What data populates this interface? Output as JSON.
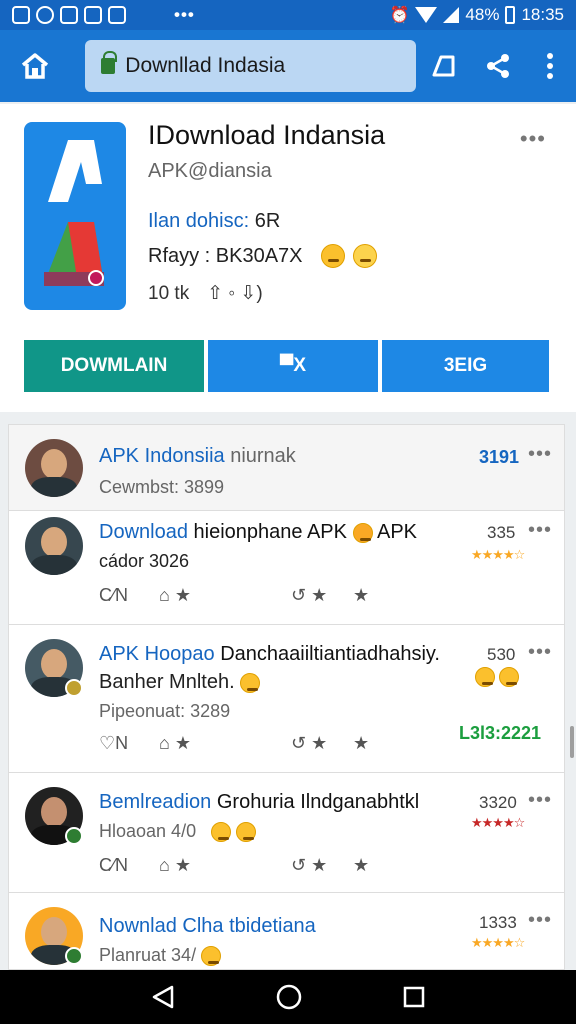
{
  "status": {
    "battery": "48%",
    "time": "18:35",
    "dots": "•••"
  },
  "toolbar": {
    "url_text": "Downllad Indasia"
  },
  "app": {
    "name": "IDownload Indansia",
    "subtitle": "APK@diansia",
    "meta1_label": "Ilan dohisc:",
    "meta1_value": "6R",
    "meta2_text": "Rfayy : BK30A7X",
    "meta3_count": "10 tk",
    "meta3_actions": "⇧ ◦ ⇩)",
    "more": "•••"
  },
  "buttons": {
    "download": "DOWMLAIN",
    "middle": "▀X",
    "right": "3EIG"
  },
  "reviews": [
    {
      "title_blue": "APK Indonsiia",
      "title_rest": " niurnak",
      "subtitle": "Cewmbst: 3899",
      "count": "3191",
      "more": "•••"
    },
    {
      "title_blue": "Download",
      "title_rest": " hieionphane APK",
      "title_rest2": " APK",
      "line2": "cádor 3026",
      "count": "335",
      "more": "•••",
      "actions": [
        "C⁄N",
        "⌂ ★",
        "↺ ★",
        "★"
      ]
    },
    {
      "title_blue": "APK Hoopao",
      "title_rest": " Danchaaiiltiantiadhahsiy.",
      "line2": "Banher Mnlteh.",
      "subtitle": "Pipeonuat: 3289",
      "count": "530",
      "tag": "L3l3:2221",
      "more": "•••",
      "actions": [
        "♡N",
        "⌂ ★",
        "↺ ★",
        "★"
      ]
    },
    {
      "title_blue": "Bemlreadion",
      "title_rest": " Grohuria Ilndganabhtkl",
      "subtitle": "Hloaoan 4/0",
      "count": "3320",
      "more": "•••",
      "actions": [
        "C⁄N",
        "⌂ ★",
        "↺ ★",
        "★"
      ]
    },
    {
      "title_blue": "Nownlad Clha tbidetiana",
      "title_rest": "",
      "subtitle": "Planruat 34/",
      "count": "1333",
      "more": "•••"
    }
  ],
  "icons": {
    "home": "home-icon",
    "tabs": "tabs-icon",
    "share": "share-icon",
    "menu": "overflow-menu-icon"
  },
  "colors": {
    "app_bar": "#1976d2",
    "download_button": "#109688",
    "secondary_button": "#1e88e5",
    "link_blue": "#1565c0",
    "tag_green": "#1b9e3e"
  }
}
